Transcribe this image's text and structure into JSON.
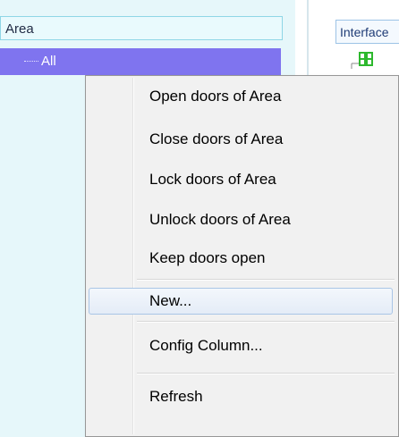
{
  "area_panel": {
    "header": "Area",
    "tree": {
      "selected_item": "All"
    }
  },
  "interface_panel": {
    "tab_label": "Interface"
  },
  "context_menu": {
    "items": [
      {
        "label": "Open doors of Area"
      },
      {
        "label": "Close doors of Area"
      },
      {
        "label": "Lock doors of Area"
      },
      {
        "label": "Unlock doors of Area"
      },
      {
        "label": "Keep doors open"
      },
      {
        "label": "New..."
      },
      {
        "label": "Config Column..."
      },
      {
        "label": "Refresh"
      }
    ],
    "highlighted_index": 5
  },
  "colors": {
    "selection": "#7f74ef",
    "panel_background": "#e6f7fa",
    "menu_background": "#f1f1f1",
    "header_border": "#8fd6e6",
    "door_icon": "#2db82d"
  },
  "icons": {
    "door": "door-icon"
  }
}
